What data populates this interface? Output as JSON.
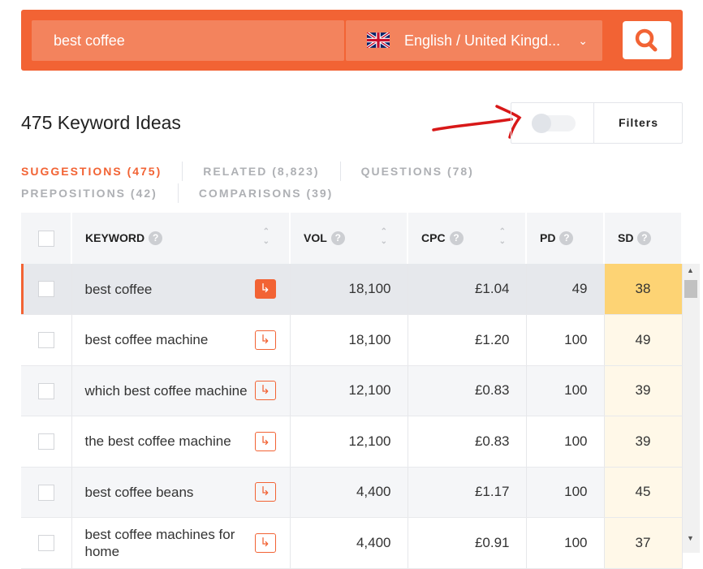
{
  "search": {
    "query": "best coffee",
    "language": "English / United Kingd..."
  },
  "header": {
    "title": "475 Keyword Ideas",
    "filters_label": "Filters"
  },
  "tabs": [
    "SUGGESTIONS (475)",
    "RELATED (8,823)",
    "QUESTIONS (78)",
    "PREPOSITIONS (42)",
    "COMPARISONS (39)"
  ],
  "columns": {
    "keyword": "KEYWORD",
    "vol": "VOL",
    "cpc": "CPC",
    "pd": "PD",
    "sd": "SD",
    "help": "?"
  },
  "rows": [
    {
      "keyword": "best coffee",
      "vol": "18,100",
      "cpc": "£1.04",
      "pd": "49",
      "sd": "38"
    },
    {
      "keyword": "best coffee machine",
      "vol": "18,100",
      "cpc": "£1.20",
      "pd": "100",
      "sd": "49"
    },
    {
      "keyword": "which best coffee machine",
      "vol": "12,100",
      "cpc": "£0.83",
      "pd": "100",
      "sd": "39"
    },
    {
      "keyword": "the best coffee machine",
      "vol": "12,100",
      "cpc": "£0.83",
      "pd": "100",
      "sd": "39"
    },
    {
      "keyword": "best coffee beans",
      "vol": "4,400",
      "cpc": "£1.17",
      "pd": "100",
      "sd": "45"
    },
    {
      "keyword": "best coffee machines for home",
      "vol": "4,400",
      "cpc": "£0.91",
      "pd": "100",
      "sd": "37"
    }
  ],
  "colors": {
    "accent": "#f26334",
    "sd_highlight": "#fdd374"
  }
}
